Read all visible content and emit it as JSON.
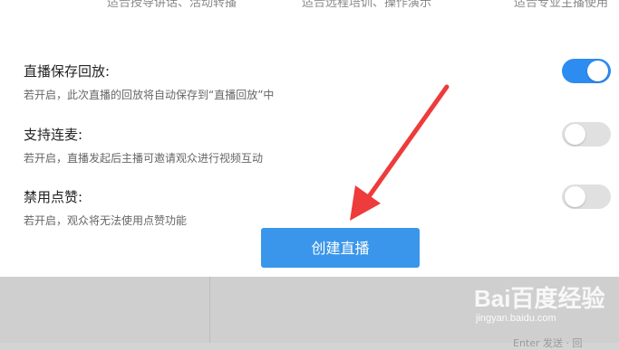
{
  "top_options": [
    "适合授导讲话、活动转播",
    "适合远程培训、操作演示",
    "适合专业主播使用"
  ],
  "settings": [
    {
      "title": "直播保存回放:",
      "description": "若开启，此次直播的回放将自动保存到“直播回放”中",
      "enabled": true
    },
    {
      "title": "支持连麦:",
      "description": "若开启，直播发起后主播可邀请观众进行视频互动",
      "enabled": false
    },
    {
      "title": "禁用点赞:",
      "description": "若开启，观众将无法使用点赞功能",
      "enabled": false
    }
  ],
  "create_button": "创建直播",
  "watermark": {
    "brand": "Bai百度经验",
    "url": "jingyan.baidu.com"
  },
  "background": {
    "footer_text": "Enter 发送 · 回"
  },
  "colors": {
    "toggle_on": "#2d8cf0",
    "toggle_off": "#e0e0e0",
    "button": "#3a96ea",
    "arrow": "#ee3b3b"
  }
}
